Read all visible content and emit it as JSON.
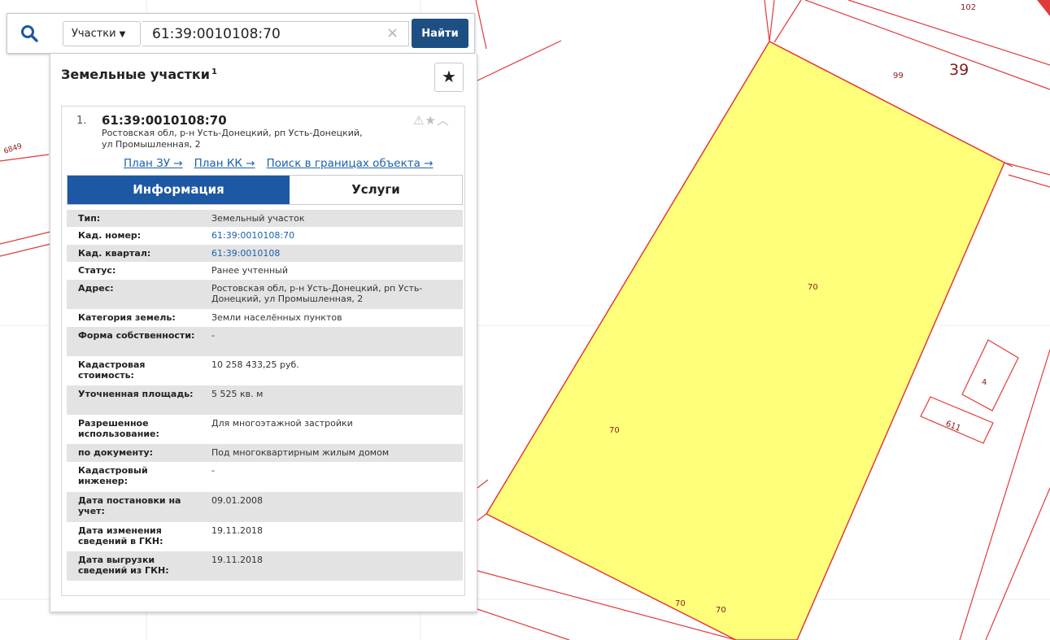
{
  "search": {
    "type_label": "Участки",
    "query": "61:39:0010108:70",
    "find_label": "Найти"
  },
  "panel": {
    "title": "Земельные участки",
    "count": "1",
    "item": {
      "number": "1.",
      "cadastral": "61:39:0010108:70",
      "address": "Ростовская обл, р-н Усть-Донецкий, рп Усть-Донецкий, ул Промышленная, 2",
      "links": [
        "План ЗУ →",
        "План КК →",
        "Поиск в границах объекта →"
      ],
      "tabs": {
        "info": "Информация",
        "services": "Услуги"
      },
      "fields": [
        {
          "label": "Тип:",
          "value": "Земельный участок"
        },
        {
          "label": "Кад. номер:",
          "value": "61:39:0010108:70"
        },
        {
          "label": "Кад. квартал:",
          "value": "61:39:0010108"
        },
        {
          "label": "Статус:",
          "value": "Ранее учтенный"
        },
        {
          "label": "Адрес:",
          "value": "Ростовская обл, р-н Усть-Донецкий, рп Усть-Донецкий, ул Промышленная, 2"
        },
        {
          "label": "Категория земель:",
          "value": "Земли населённых пунктов"
        },
        {
          "label": "Форма собственности:",
          "value": "-"
        },
        {
          "label": "Кадастровая стоимость:",
          "value": "10 258 433,25 руб."
        },
        {
          "label": "Уточненная площадь:",
          "value": "5 525 кв. м"
        },
        {
          "label": "Разрешенное использование:",
          "value": "Для многоэтажной застройки"
        },
        {
          "label": "по документу:",
          "value": "Под многоквартирным жилым домом"
        },
        {
          "label": "Кадастровый инженер:",
          "value": "-"
        },
        {
          "label": "Дата постановки на учет:",
          "value": "09.01.2008"
        },
        {
          "label": "Дата изменения сведений в ГКН:",
          "value": "19.11.2018"
        },
        {
          "label": "Дата выгрузки сведений из ГКН:",
          "value": "19.11.2018"
        }
      ]
    }
  },
  "map": {
    "labels": {
      "l102": "102",
      "l99": "99",
      "l39": "39",
      "l70a": "70",
      "l70b": "70",
      "l70c": "70",
      "l70d": "70",
      "l4": "4",
      "l611": "611",
      "l6849": "6849"
    }
  }
}
